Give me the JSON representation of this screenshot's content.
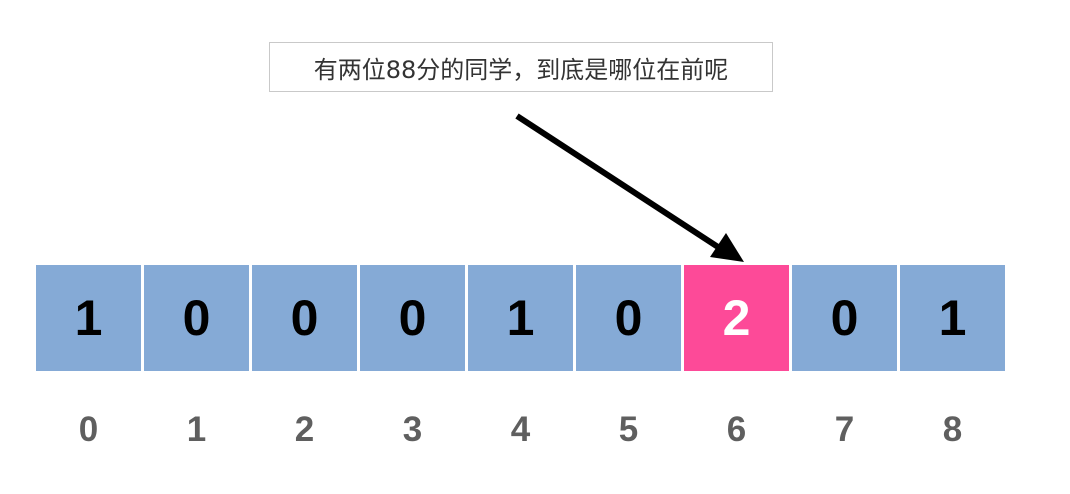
{
  "callout": {
    "text": "有两位88分的同学，到底是哪位在前呢"
  },
  "array": {
    "values": [
      "1",
      "0",
      "0",
      "0",
      "1",
      "0",
      "2",
      "0",
      "1"
    ],
    "indices": [
      "0",
      "1",
      "2",
      "3",
      "4",
      "5",
      "6",
      "7",
      "8"
    ],
    "highlight_index": 6
  },
  "colors": {
    "cell_default": "#85aad6",
    "cell_highlight": "#fd4a98",
    "text_default": "#000000",
    "text_highlight": "#ffffff",
    "index_text": "#5f5f5f",
    "arrow": "#000000"
  }
}
